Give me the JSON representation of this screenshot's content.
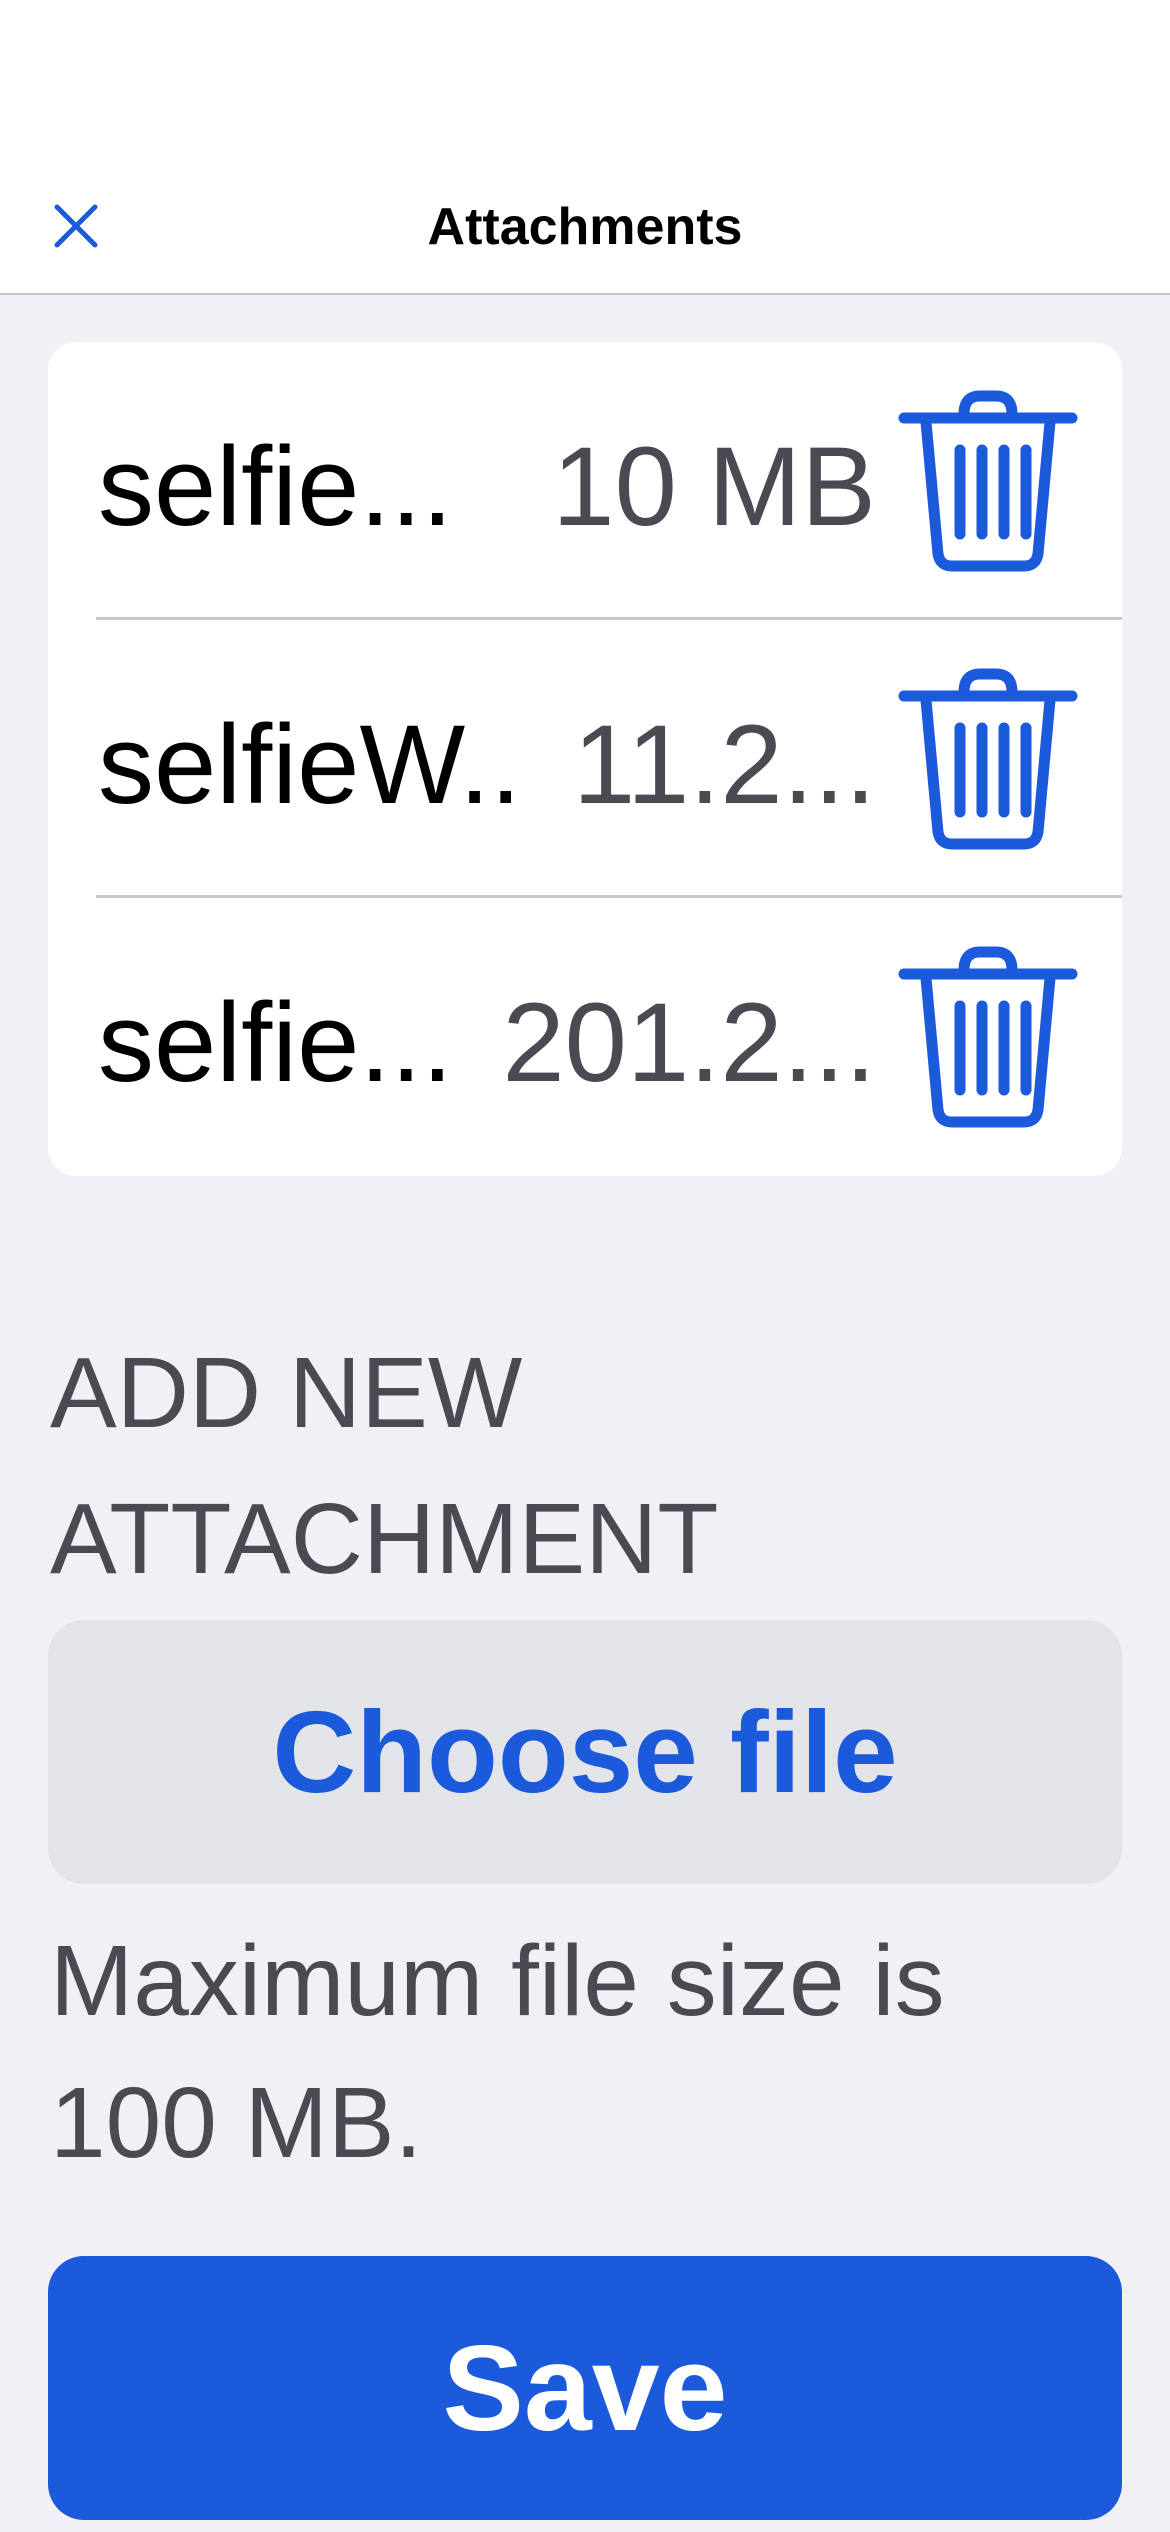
{
  "header": {
    "title": "Attachments",
    "close_icon": "close-icon"
  },
  "attachments": [
    {
      "name": "selfie...",
      "size": "10 MB"
    },
    {
      "name": "selfieW...",
      "size": "11.2..."
    },
    {
      "name": "selfie...",
      "size": "201.2..."
    }
  ],
  "add_section": {
    "label": "ADD NEW ATTACHMENT",
    "choose_label": "Choose file",
    "help_text": "Maximum file size is 100 MB."
  },
  "footer": {
    "save_label": "Save"
  },
  "colors": {
    "accent": "#1a5adb",
    "background": "#f0f0f5",
    "card": "#ffffff",
    "secondary_text": "#4a4a52"
  }
}
